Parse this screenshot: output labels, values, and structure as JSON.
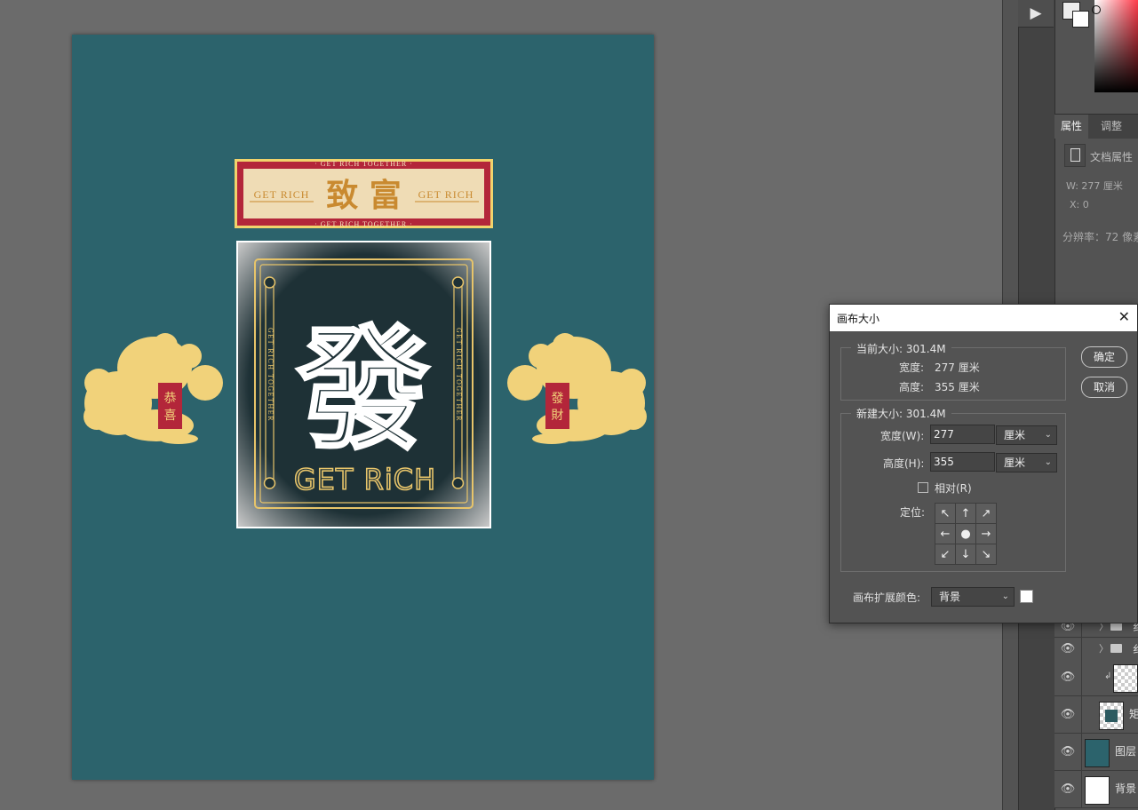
{
  "window": {
    "tool_strip_play": "▶"
  },
  "panel": {
    "tabs": [
      "属性",
      "调整"
    ],
    "doc_properties_label": "文档属性",
    "width_readout": "W:  277 厘米",
    "x_readout": "X:  0",
    "resolution_readout": "分辨率：72 像素"
  },
  "artwork": {
    "banner_top_text": "· GET RICH TOGETHER ·",
    "banner_bottom_text": "· GET RICH TOGETHER ·",
    "banner_title": "致 富",
    "banner_side_left": "GET RICH",
    "banner_side_right": "GET RICH",
    "main_character": "發",
    "main_caption": "GET RiCH",
    "scroll_text": "GET RICH TOGETHER",
    "lion_left_scroll": "恭喜",
    "lion_right_scroll": "發財"
  },
  "layers": [
    {
      "name": "纟",
      "type": "folder"
    },
    {
      "name": "纟",
      "type": "folder"
    },
    {
      "name": "",
      "type": "clipped"
    },
    {
      "name": "矩",
      "type": "shape"
    },
    {
      "name": "图层",
      "type": "fill"
    },
    {
      "name": "背景",
      "type": "background"
    }
  ],
  "dialog": {
    "title": "画布大小",
    "close": "✕",
    "current_size_label": "当前大小: 301.4M",
    "current_width_label": "宽度:",
    "current_width_value": "277 厘米",
    "current_height_label": "高度:",
    "current_height_value": "355 厘米",
    "new_size_label": "新建大小: 301.4M",
    "width_label": "宽度(W):",
    "width_value": "277",
    "width_unit": "厘米",
    "height_label": "高度(H):",
    "height_value": "355",
    "height_unit": "厘米",
    "relative_label": "相对(R)",
    "relative_checked": false,
    "anchor_label": "定位:",
    "anchor_arrows": [
      "↖",
      "↑",
      "↗",
      "←",
      "●",
      "→",
      "↙",
      "↓",
      "↘"
    ],
    "extension_color_label": "画布扩展颜色:",
    "extension_color_value": "背景",
    "extension_color_swatch": "#ffffff",
    "ok_button": "确定",
    "cancel_button": "取消"
  },
  "colors": {
    "canvas_teal": "#2c636c",
    "gold": "#e7c46a",
    "red": "#b3263a",
    "cream": "#efdcb5",
    "dark_panel": "#1e3136"
  }
}
